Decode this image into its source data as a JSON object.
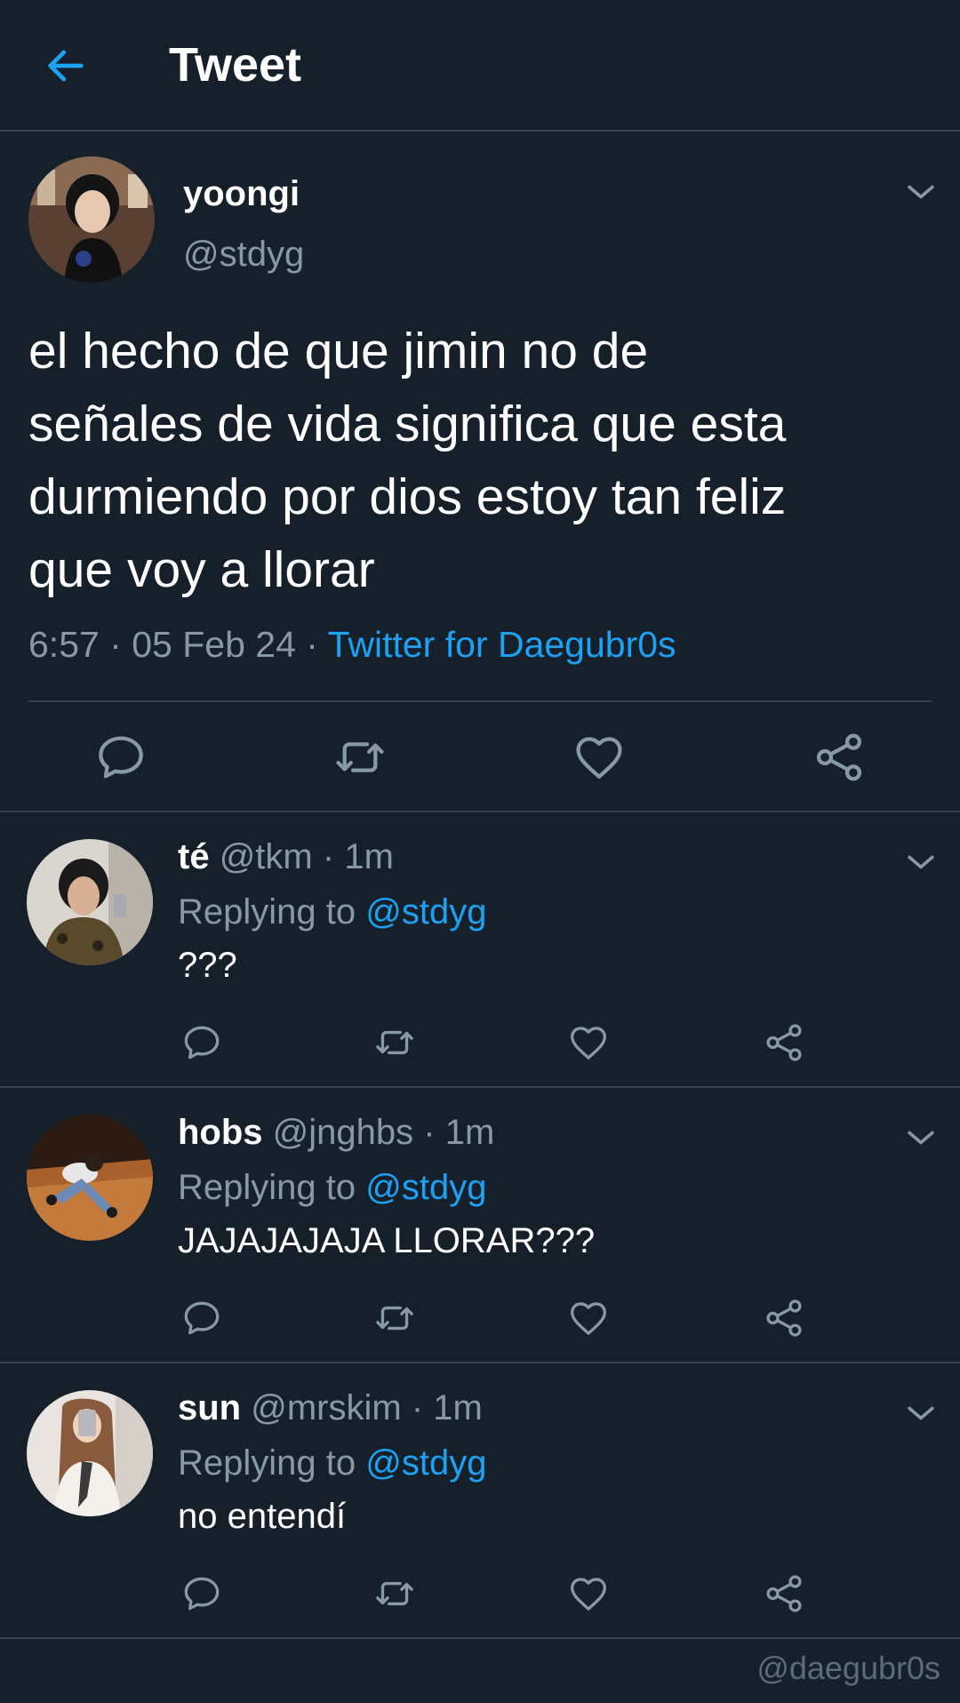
{
  "header": {
    "title": "Tweet",
    "back_icon": "back-arrow-icon"
  },
  "main_tweet": {
    "display_name": "yoongi",
    "handle": "@stdyg",
    "text": "el hecho de que jimin no de\nseñales de vida significa que esta\ndurmiendo por dios estoy tan feliz\nque voy a llorar",
    "time": "6:57",
    "date": "05 Feb 24",
    "source": "Twitter for Daegubr0s",
    "separator": " · "
  },
  "replies": [
    {
      "display_name": "té",
      "handle": "@tkm",
      "time": "1m",
      "replying_label": "Replying to",
      "replying_to": "@stdyg",
      "text": "???"
    },
    {
      "display_name": "hobs",
      "handle": "@jnghbs",
      "time": "1m",
      "replying_label": "Replying to",
      "replying_to": "@stdyg",
      "text": "JAJAJAJAJA LLORAR???"
    },
    {
      "display_name": "sun",
      "handle": "@mrskim",
      "time": "1m",
      "replying_label": "Replying to",
      "replying_to": "@stdyg",
      "text": "no entendí"
    }
  ],
  "watermark": "@daegubr0s",
  "colors": {
    "background": "#15202b",
    "accent": "#1da1f2",
    "secondary_text": "#8899a6",
    "divider": "#38444d"
  },
  "icons": [
    "back-arrow-icon",
    "chevron-down-icon",
    "reply-icon",
    "retweet-icon",
    "like-icon",
    "share-icon"
  ]
}
